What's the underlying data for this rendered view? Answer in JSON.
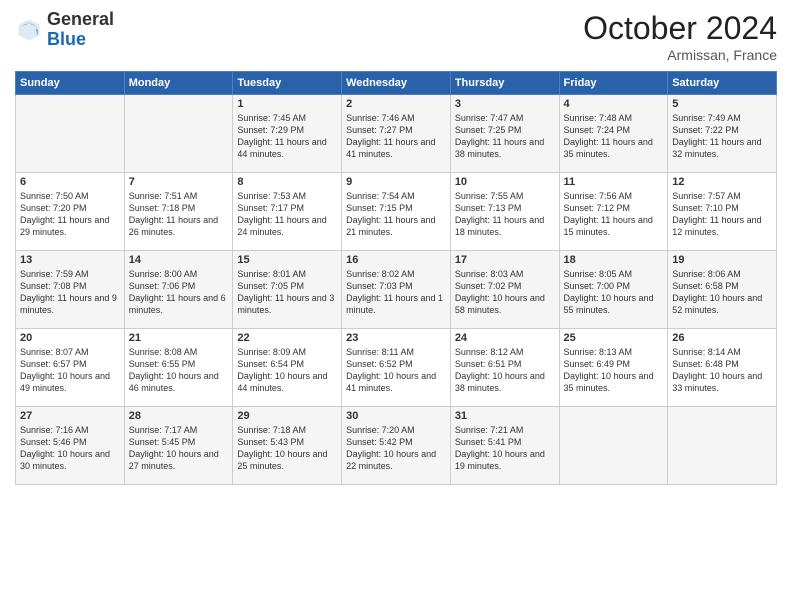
{
  "header": {
    "logo": {
      "general": "General",
      "blue": "Blue"
    },
    "title": "October 2024",
    "subtitle": "Armissan, France"
  },
  "calendar": {
    "days_of_week": [
      "Sunday",
      "Monday",
      "Tuesday",
      "Wednesday",
      "Thursday",
      "Friday",
      "Saturday"
    ],
    "weeks": [
      [
        {
          "day": "",
          "sunrise": "",
          "sunset": "",
          "daylight": ""
        },
        {
          "day": "",
          "sunrise": "",
          "sunset": "",
          "daylight": ""
        },
        {
          "day": "1",
          "sunrise": "Sunrise: 7:45 AM",
          "sunset": "Sunset: 7:29 PM",
          "daylight": "Daylight: 11 hours and 44 minutes."
        },
        {
          "day": "2",
          "sunrise": "Sunrise: 7:46 AM",
          "sunset": "Sunset: 7:27 PM",
          "daylight": "Daylight: 11 hours and 41 minutes."
        },
        {
          "day": "3",
          "sunrise": "Sunrise: 7:47 AM",
          "sunset": "Sunset: 7:25 PM",
          "daylight": "Daylight: 11 hours and 38 minutes."
        },
        {
          "day": "4",
          "sunrise": "Sunrise: 7:48 AM",
          "sunset": "Sunset: 7:24 PM",
          "daylight": "Daylight: 11 hours and 35 minutes."
        },
        {
          "day": "5",
          "sunrise": "Sunrise: 7:49 AM",
          "sunset": "Sunset: 7:22 PM",
          "daylight": "Daylight: 11 hours and 32 minutes."
        }
      ],
      [
        {
          "day": "6",
          "sunrise": "Sunrise: 7:50 AM",
          "sunset": "Sunset: 7:20 PM",
          "daylight": "Daylight: 11 hours and 29 minutes."
        },
        {
          "day": "7",
          "sunrise": "Sunrise: 7:51 AM",
          "sunset": "Sunset: 7:18 PM",
          "daylight": "Daylight: 11 hours and 26 minutes."
        },
        {
          "day": "8",
          "sunrise": "Sunrise: 7:53 AM",
          "sunset": "Sunset: 7:17 PM",
          "daylight": "Daylight: 11 hours and 24 minutes."
        },
        {
          "day": "9",
          "sunrise": "Sunrise: 7:54 AM",
          "sunset": "Sunset: 7:15 PM",
          "daylight": "Daylight: 11 hours and 21 minutes."
        },
        {
          "day": "10",
          "sunrise": "Sunrise: 7:55 AM",
          "sunset": "Sunset: 7:13 PM",
          "daylight": "Daylight: 11 hours and 18 minutes."
        },
        {
          "day": "11",
          "sunrise": "Sunrise: 7:56 AM",
          "sunset": "Sunset: 7:12 PM",
          "daylight": "Daylight: 11 hours and 15 minutes."
        },
        {
          "day": "12",
          "sunrise": "Sunrise: 7:57 AM",
          "sunset": "Sunset: 7:10 PM",
          "daylight": "Daylight: 11 hours and 12 minutes."
        }
      ],
      [
        {
          "day": "13",
          "sunrise": "Sunrise: 7:59 AM",
          "sunset": "Sunset: 7:08 PM",
          "daylight": "Daylight: 11 hours and 9 minutes."
        },
        {
          "day": "14",
          "sunrise": "Sunrise: 8:00 AM",
          "sunset": "Sunset: 7:06 PM",
          "daylight": "Daylight: 11 hours and 6 minutes."
        },
        {
          "day": "15",
          "sunrise": "Sunrise: 8:01 AM",
          "sunset": "Sunset: 7:05 PM",
          "daylight": "Daylight: 11 hours and 3 minutes."
        },
        {
          "day": "16",
          "sunrise": "Sunrise: 8:02 AM",
          "sunset": "Sunset: 7:03 PM",
          "daylight": "Daylight: 11 hours and 1 minute."
        },
        {
          "day": "17",
          "sunrise": "Sunrise: 8:03 AM",
          "sunset": "Sunset: 7:02 PM",
          "daylight": "Daylight: 10 hours and 58 minutes."
        },
        {
          "day": "18",
          "sunrise": "Sunrise: 8:05 AM",
          "sunset": "Sunset: 7:00 PM",
          "daylight": "Daylight: 10 hours and 55 minutes."
        },
        {
          "day": "19",
          "sunrise": "Sunrise: 8:06 AM",
          "sunset": "Sunset: 6:58 PM",
          "daylight": "Daylight: 10 hours and 52 minutes."
        }
      ],
      [
        {
          "day": "20",
          "sunrise": "Sunrise: 8:07 AM",
          "sunset": "Sunset: 6:57 PM",
          "daylight": "Daylight: 10 hours and 49 minutes."
        },
        {
          "day": "21",
          "sunrise": "Sunrise: 8:08 AM",
          "sunset": "Sunset: 6:55 PM",
          "daylight": "Daylight: 10 hours and 46 minutes."
        },
        {
          "day": "22",
          "sunrise": "Sunrise: 8:09 AM",
          "sunset": "Sunset: 6:54 PM",
          "daylight": "Daylight: 10 hours and 44 minutes."
        },
        {
          "day": "23",
          "sunrise": "Sunrise: 8:11 AM",
          "sunset": "Sunset: 6:52 PM",
          "daylight": "Daylight: 10 hours and 41 minutes."
        },
        {
          "day": "24",
          "sunrise": "Sunrise: 8:12 AM",
          "sunset": "Sunset: 6:51 PM",
          "daylight": "Daylight: 10 hours and 38 minutes."
        },
        {
          "day": "25",
          "sunrise": "Sunrise: 8:13 AM",
          "sunset": "Sunset: 6:49 PM",
          "daylight": "Daylight: 10 hours and 35 minutes."
        },
        {
          "day": "26",
          "sunrise": "Sunrise: 8:14 AM",
          "sunset": "Sunset: 6:48 PM",
          "daylight": "Daylight: 10 hours and 33 minutes."
        }
      ],
      [
        {
          "day": "27",
          "sunrise": "Sunrise: 7:16 AM",
          "sunset": "Sunset: 5:46 PM",
          "daylight": "Daylight: 10 hours and 30 minutes."
        },
        {
          "day": "28",
          "sunrise": "Sunrise: 7:17 AM",
          "sunset": "Sunset: 5:45 PM",
          "daylight": "Daylight: 10 hours and 27 minutes."
        },
        {
          "day": "29",
          "sunrise": "Sunrise: 7:18 AM",
          "sunset": "Sunset: 5:43 PM",
          "daylight": "Daylight: 10 hours and 25 minutes."
        },
        {
          "day": "30",
          "sunrise": "Sunrise: 7:20 AM",
          "sunset": "Sunset: 5:42 PM",
          "daylight": "Daylight: 10 hours and 22 minutes."
        },
        {
          "day": "31",
          "sunrise": "Sunrise: 7:21 AM",
          "sunset": "Sunset: 5:41 PM",
          "daylight": "Daylight: 10 hours and 19 minutes."
        },
        {
          "day": "",
          "sunrise": "",
          "sunset": "",
          "daylight": ""
        },
        {
          "day": "",
          "sunrise": "",
          "sunset": "",
          "daylight": ""
        }
      ]
    ]
  }
}
